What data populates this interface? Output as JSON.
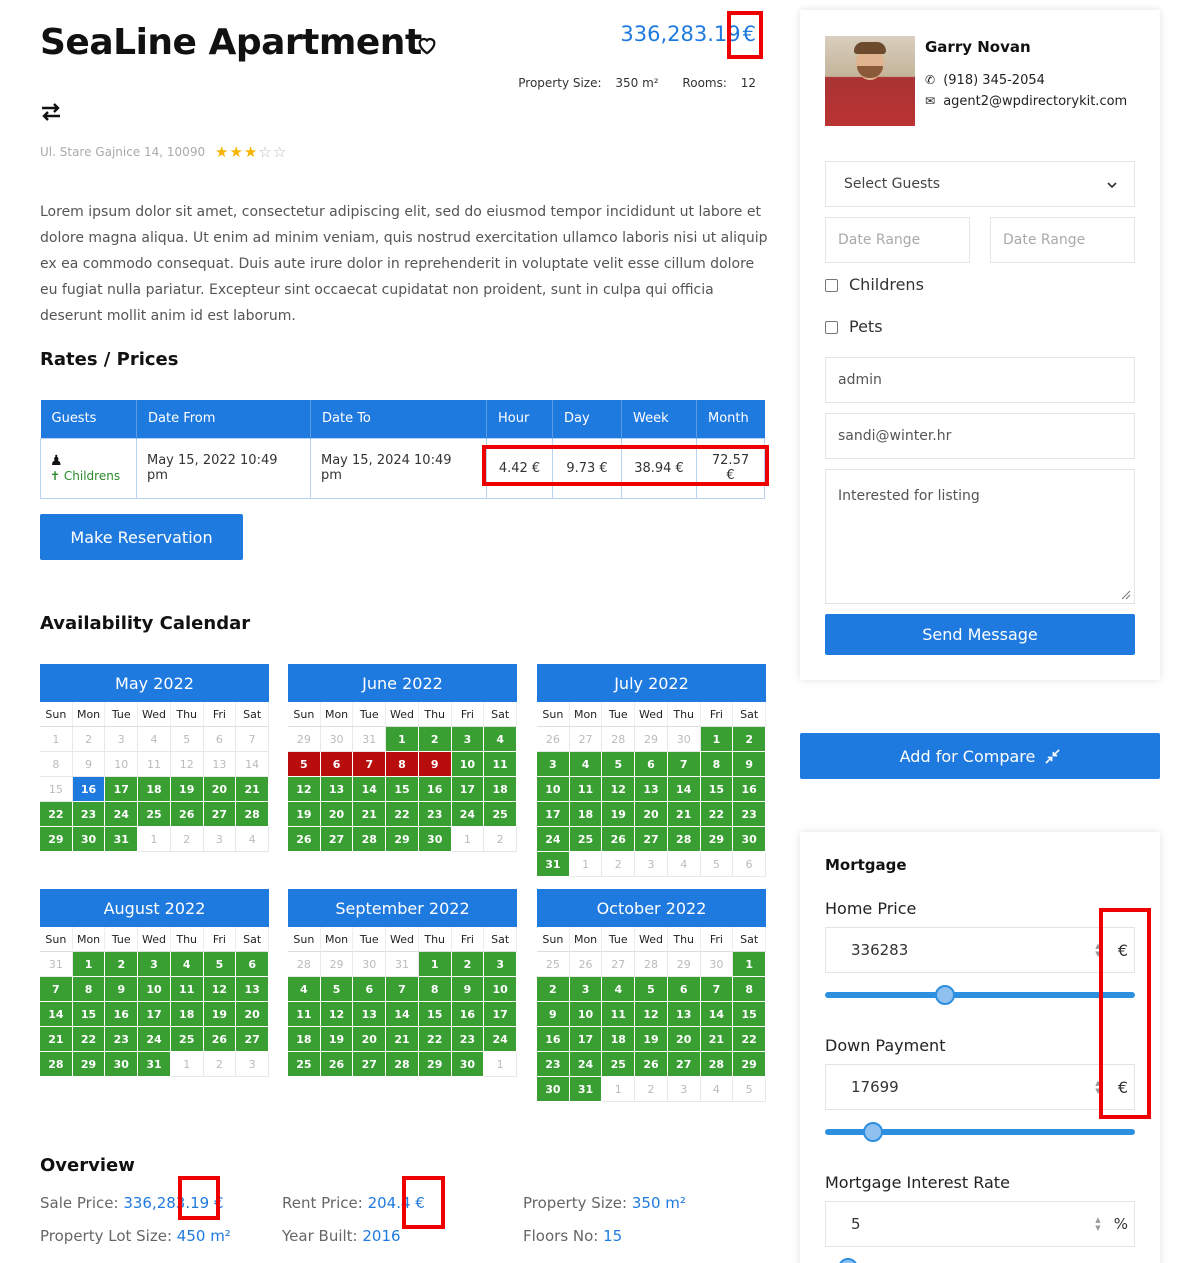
{
  "listing": {
    "title": "SeaLine Apartment",
    "price": "336,283.19",
    "currency": "€",
    "property_size_label": "Property Size:",
    "property_size_value": "350 m²",
    "rooms_label": "Rooms:",
    "rooms_value": "12",
    "address": "Ul. Stare Gajnice 14, 10090",
    "rating": 3,
    "rating_max": 5,
    "description": "Lorem ipsum dolor sit amet, consectetur adipiscing elit, sed do eiusmod tempor incididunt ut labore et dolore magna aliqua. Ut enim ad minim veniam, quis nostrud exercitation ullamco laboris nisi ut aliquip ex ea commodo consequat. Duis aute irure dolor in reprehenderit in voluptate velit esse cillum dolore eu fugiat nulla pariatur. Excepteur sint occaecat cupidatat non proident, sunt in culpa qui officia deserunt mollit anim id est laborum."
  },
  "rates": {
    "heading": "Rates / Prices",
    "columns": [
      "Guests",
      "Date From",
      "Date To",
      "Hour",
      "Day",
      "Week",
      "Month"
    ],
    "row": {
      "guest_label": "Childrens",
      "date_from": "May 15, 2022 10:49 pm",
      "date_to": "May 15, 2024 10:49 pm",
      "hour": "4.42 €",
      "day": "9.73 €",
      "week": "38.94 €",
      "month": "72.57 €"
    },
    "reserve_button": "Make Reservation"
  },
  "calendar": {
    "heading": "Availability Calendar",
    "weekdays": [
      "Sun",
      "Mon",
      "Tue",
      "Wed",
      "Thu",
      "Fri",
      "Sat"
    ],
    "months": [
      {
        "name": "May 2022",
        "cells": [
          [
            "1",
            "e"
          ],
          [
            "2",
            "e"
          ],
          [
            "3",
            "e"
          ],
          [
            "4",
            "e"
          ],
          [
            "5",
            "e"
          ],
          [
            "6",
            "e"
          ],
          [
            "7",
            "e"
          ],
          [
            "8",
            "e"
          ],
          [
            "9",
            "e"
          ],
          [
            "10",
            "e"
          ],
          [
            "11",
            "e"
          ],
          [
            "12",
            "e"
          ],
          [
            "13",
            "e"
          ],
          [
            "14",
            "e"
          ],
          [
            "15",
            "e"
          ],
          [
            "16",
            "b"
          ],
          [
            "17",
            "g"
          ],
          [
            "18",
            "g"
          ],
          [
            "19",
            "g"
          ],
          [
            "20",
            "g"
          ],
          [
            "21",
            "g"
          ],
          [
            "22",
            "g"
          ],
          [
            "23",
            "g"
          ],
          [
            "24",
            "g"
          ],
          [
            "25",
            "g"
          ],
          [
            "26",
            "g"
          ],
          [
            "27",
            "g"
          ],
          [
            "28",
            "g"
          ],
          [
            "29",
            "g"
          ],
          [
            "30",
            "g"
          ],
          [
            "31",
            "g"
          ],
          [
            "1",
            "e"
          ],
          [
            "2",
            "e"
          ],
          [
            "3",
            "e"
          ],
          [
            "4",
            "e"
          ]
        ]
      },
      {
        "name": "June 2022",
        "cells": [
          [
            "29",
            "e"
          ],
          [
            "30",
            "e"
          ],
          [
            "31",
            "e"
          ],
          [
            "1",
            "g"
          ],
          [
            "2",
            "g"
          ],
          [
            "3",
            "g"
          ],
          [
            "4",
            "g"
          ],
          [
            "5",
            "r"
          ],
          [
            "6",
            "r"
          ],
          [
            "7",
            "r"
          ],
          [
            "8",
            "r"
          ],
          [
            "9",
            "r"
          ],
          [
            "10",
            "g"
          ],
          [
            "11",
            "g"
          ],
          [
            "12",
            "g"
          ],
          [
            "13",
            "g"
          ],
          [
            "14",
            "g"
          ],
          [
            "15",
            "g"
          ],
          [
            "16",
            "g"
          ],
          [
            "17",
            "g"
          ],
          [
            "18",
            "g"
          ],
          [
            "19",
            "g"
          ],
          [
            "20",
            "g"
          ],
          [
            "21",
            "g"
          ],
          [
            "22",
            "g"
          ],
          [
            "23",
            "g"
          ],
          [
            "24",
            "g"
          ],
          [
            "25",
            "g"
          ],
          [
            "26",
            "g"
          ],
          [
            "27",
            "g"
          ],
          [
            "28",
            "g"
          ],
          [
            "29",
            "g"
          ],
          [
            "30",
            "g"
          ],
          [
            "1",
            "e"
          ],
          [
            "2",
            "e"
          ]
        ]
      },
      {
        "name": "July 2022",
        "cells": [
          [
            "26",
            "e"
          ],
          [
            "27",
            "e"
          ],
          [
            "28",
            "e"
          ],
          [
            "29",
            "e"
          ],
          [
            "30",
            "e"
          ],
          [
            "1",
            "g"
          ],
          [
            "2",
            "g"
          ],
          [
            "3",
            "g"
          ],
          [
            "4",
            "g"
          ],
          [
            "5",
            "g"
          ],
          [
            "6",
            "g"
          ],
          [
            "7",
            "g"
          ],
          [
            "8",
            "g"
          ],
          [
            "9",
            "g"
          ],
          [
            "10",
            "g"
          ],
          [
            "11",
            "g"
          ],
          [
            "12",
            "g"
          ],
          [
            "13",
            "g"
          ],
          [
            "14",
            "g"
          ],
          [
            "15",
            "g"
          ],
          [
            "16",
            "g"
          ],
          [
            "17",
            "g"
          ],
          [
            "18",
            "g"
          ],
          [
            "19",
            "g"
          ],
          [
            "20",
            "g"
          ],
          [
            "21",
            "g"
          ],
          [
            "22",
            "g"
          ],
          [
            "23",
            "g"
          ],
          [
            "24",
            "g"
          ],
          [
            "25",
            "g"
          ],
          [
            "26",
            "g"
          ],
          [
            "27",
            "g"
          ],
          [
            "28",
            "g"
          ],
          [
            "29",
            "g"
          ],
          [
            "30",
            "g"
          ],
          [
            "31",
            "g"
          ],
          [
            "1",
            "e"
          ],
          [
            "2",
            "e"
          ],
          [
            "3",
            "e"
          ],
          [
            "4",
            "e"
          ],
          [
            "5",
            "e"
          ],
          [
            "6",
            "e"
          ]
        ]
      },
      {
        "name": "August 2022",
        "cells": [
          [
            "31",
            "e"
          ],
          [
            "1",
            "g"
          ],
          [
            "2",
            "g"
          ],
          [
            "3",
            "g"
          ],
          [
            "4",
            "g"
          ],
          [
            "5",
            "g"
          ],
          [
            "6",
            "g"
          ],
          [
            "7",
            "g"
          ],
          [
            "8",
            "g"
          ],
          [
            "9",
            "g"
          ],
          [
            "10",
            "g"
          ],
          [
            "11",
            "g"
          ],
          [
            "12",
            "g"
          ],
          [
            "13",
            "g"
          ],
          [
            "14",
            "g"
          ],
          [
            "15",
            "g"
          ],
          [
            "16",
            "g"
          ],
          [
            "17",
            "g"
          ],
          [
            "18",
            "g"
          ],
          [
            "19",
            "g"
          ],
          [
            "20",
            "g"
          ],
          [
            "21",
            "g"
          ],
          [
            "22",
            "g"
          ],
          [
            "23",
            "g"
          ],
          [
            "24",
            "g"
          ],
          [
            "25",
            "g"
          ],
          [
            "26",
            "g"
          ],
          [
            "27",
            "g"
          ],
          [
            "28",
            "g"
          ],
          [
            "29",
            "g"
          ],
          [
            "30",
            "g"
          ],
          [
            "31",
            "g"
          ],
          [
            "1",
            "e"
          ],
          [
            "2",
            "e"
          ],
          [
            "3",
            "e"
          ]
        ]
      },
      {
        "name": "September 2022",
        "cells": [
          [
            "28",
            "e"
          ],
          [
            "29",
            "e"
          ],
          [
            "30",
            "e"
          ],
          [
            "31",
            "e"
          ],
          [
            "1",
            "g"
          ],
          [
            "2",
            "g"
          ],
          [
            "3",
            "g"
          ],
          [
            "4",
            "g"
          ],
          [
            "5",
            "g"
          ],
          [
            "6",
            "g"
          ],
          [
            "7",
            "g"
          ],
          [
            "8",
            "g"
          ],
          [
            "9",
            "g"
          ],
          [
            "10",
            "g"
          ],
          [
            "11",
            "g"
          ],
          [
            "12",
            "g"
          ],
          [
            "13",
            "g"
          ],
          [
            "14",
            "g"
          ],
          [
            "15",
            "g"
          ],
          [
            "16",
            "g"
          ],
          [
            "17",
            "g"
          ],
          [
            "18",
            "g"
          ],
          [
            "19",
            "g"
          ],
          [
            "20",
            "g"
          ],
          [
            "21",
            "g"
          ],
          [
            "22",
            "g"
          ],
          [
            "23",
            "g"
          ],
          [
            "24",
            "g"
          ],
          [
            "25",
            "g"
          ],
          [
            "26",
            "g"
          ],
          [
            "27",
            "g"
          ],
          [
            "28",
            "g"
          ],
          [
            "29",
            "g"
          ],
          [
            "30",
            "g"
          ],
          [
            "1",
            "e"
          ]
        ]
      },
      {
        "name": "October 2022",
        "cells": [
          [
            "25",
            "e"
          ],
          [
            "26",
            "e"
          ],
          [
            "27",
            "e"
          ],
          [
            "28",
            "e"
          ],
          [
            "29",
            "e"
          ],
          [
            "30",
            "e"
          ],
          [
            "1",
            "g"
          ],
          [
            "2",
            "g"
          ],
          [
            "3",
            "g"
          ],
          [
            "4",
            "g"
          ],
          [
            "5",
            "g"
          ],
          [
            "6",
            "g"
          ],
          [
            "7",
            "g"
          ],
          [
            "8",
            "g"
          ],
          [
            "9",
            "g"
          ],
          [
            "10",
            "g"
          ],
          [
            "11",
            "g"
          ],
          [
            "12",
            "g"
          ],
          [
            "13",
            "g"
          ],
          [
            "14",
            "g"
          ],
          [
            "15",
            "g"
          ],
          [
            "16",
            "g"
          ],
          [
            "17",
            "g"
          ],
          [
            "18",
            "g"
          ],
          [
            "19",
            "g"
          ],
          [
            "20",
            "g"
          ],
          [
            "21",
            "g"
          ],
          [
            "22",
            "g"
          ],
          [
            "23",
            "g"
          ],
          [
            "24",
            "g"
          ],
          [
            "25",
            "g"
          ],
          [
            "26",
            "g"
          ],
          [
            "27",
            "g"
          ],
          [
            "28",
            "g"
          ],
          [
            "29",
            "g"
          ],
          [
            "30",
            "g"
          ],
          [
            "31",
            "g"
          ],
          [
            "1",
            "e"
          ],
          [
            "2",
            "e"
          ],
          [
            "3",
            "e"
          ],
          [
            "4",
            "e"
          ],
          [
            "5",
            "e"
          ]
        ]
      }
    ]
  },
  "overview": {
    "heading": "Overview",
    "sale_price_label": "Sale Price:",
    "sale_price_value": "336,283.19 €",
    "rent_price_label": "Rent Price:",
    "rent_price_value": "204.4 €",
    "property_size_label": "Property Size:",
    "property_size_value": "350 m²",
    "lot_size_label": "Property Lot Size:",
    "lot_size_value": "450 m²",
    "year_built_label": "Year Built:",
    "year_built_value": "2016",
    "floors_label": "Floors No:",
    "floors_value": "15"
  },
  "agent": {
    "name": "Garry Novan",
    "phone": "(918) 345-2054",
    "email": "agent2@wpdirectorykit.com"
  },
  "contact_form": {
    "guests_placeholder": "Select Guests",
    "date_range_1": "Date Range",
    "date_range_2": "Date Range",
    "childrens_label": "Childrens",
    "pets_label": "Pets",
    "name_value": "admin",
    "email_value": "sandi@winter.hr",
    "message_value": "Interested for listing",
    "send_button": "Send Message"
  },
  "compare": {
    "button": "Add for Compare"
  },
  "mortgage": {
    "heading": "Mortgage",
    "home_price_label": "Home Price",
    "home_price_value": "336283",
    "home_price_unit": "€",
    "home_price_slider": 0.38,
    "down_payment_label": "Down Payment",
    "down_payment_value": "17699",
    "down_payment_unit": "€",
    "down_payment_slider": 0.13,
    "interest_label": "Mortgage Interest Rate",
    "interest_value": "5",
    "interest_unit": "%"
  },
  "colors": {
    "accent": "#1f7ae0",
    "available": "#3a9f32",
    "booked": "#b80d0d",
    "highlight": "#e00000"
  }
}
